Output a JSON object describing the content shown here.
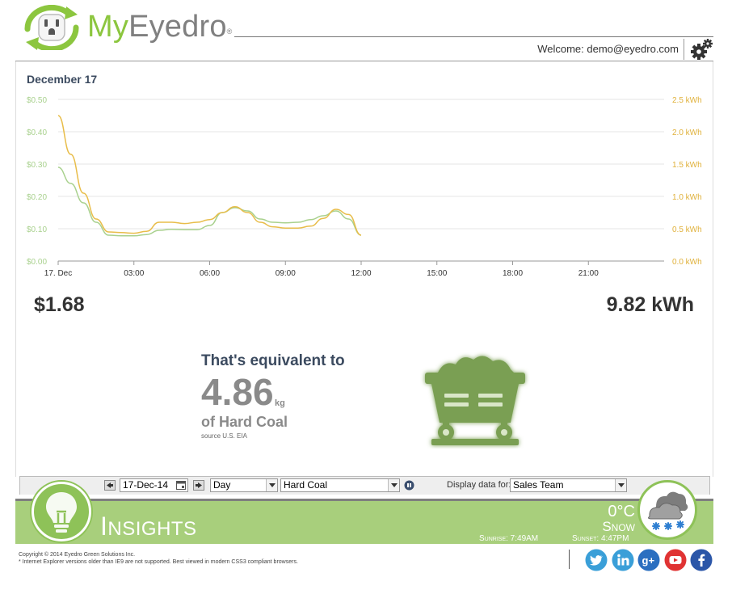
{
  "header": {
    "brand_my": "My",
    "brand_eyedro": "Eyedro",
    "brand_mark": "®",
    "welcome_text": "Welcome:  demo@eyedro.com"
  },
  "chart_data": {
    "type": "line",
    "title": "December 17",
    "x_ticks": [
      "17. Dec",
      "03:00",
      "06:00",
      "09:00",
      "12:00",
      "15:00",
      "18:00",
      "21:00"
    ],
    "x_range_hours": [
      0,
      24
    ],
    "y_left": {
      "ticks": [
        "$0.00",
        "$0.10",
        "$0.20",
        "$0.30",
        "$0.40",
        "$0.50"
      ],
      "range": [
        0,
        0.5
      ]
    },
    "y_right": {
      "ticks": [
        "0.0 kWh",
        "0.5 kWh",
        "1.0 kWh",
        "1.5 kWh",
        "2.0 kWh",
        "2.5 kWh"
      ],
      "range": [
        0,
        2.5
      ]
    },
    "grid": true,
    "series": [
      {
        "axis": "left",
        "color": "#a9d18e",
        "x": [
          0,
          0.5,
          1,
          1.5,
          2,
          2.5,
          3,
          3.5,
          4,
          4.5,
          5,
          5.5,
          6,
          6.5,
          7,
          7.5,
          8,
          8.5,
          9,
          9.5,
          10,
          10.5,
          11,
          11.5,
          12
        ],
        "y": [
          0.29,
          0.24,
          0.18,
          0.12,
          0.08,
          0.078,
          0.078,
          0.082,
          0.095,
          0.098,
          0.097,
          0.097,
          0.11,
          0.15,
          0.165,
          0.155,
          0.13,
          0.12,
          0.118,
          0.12,
          0.128,
          0.14,
          0.155,
          0.13,
          0.08
        ]
      },
      {
        "axis": "right",
        "color": "#e8bd4a",
        "x": [
          0,
          0.5,
          1,
          1.5,
          2,
          2.5,
          3,
          3.5,
          4,
          4.5,
          5,
          5.5,
          6,
          6.5,
          7,
          7.5,
          8,
          8.5,
          9,
          9.5,
          10,
          10.5,
          11,
          11.5,
          12
        ],
        "y": [
          2.25,
          1.65,
          1.05,
          0.65,
          0.45,
          0.44,
          0.43,
          0.46,
          0.6,
          0.6,
          0.58,
          0.6,
          0.64,
          0.75,
          0.84,
          0.75,
          0.6,
          0.53,
          0.51,
          0.51,
          0.54,
          0.66,
          0.8,
          0.72,
          0.4
        ]
      }
    ]
  },
  "summary": {
    "total_cost": "$1.68",
    "total_energy": "9.82 kWh"
  },
  "equivalent": {
    "heading": "That's equivalent to",
    "value": "4.86",
    "unit": "kg",
    "material": "of Hard Coal",
    "source": "source U.S. EIA"
  },
  "toolbar": {
    "date_value": "17-Dec-14",
    "period_value": "Day",
    "equivalence_value": "Hard Coal",
    "display_label": "Display data for:",
    "group_value": "Sales Team"
  },
  "banner": {
    "title_first": "I",
    "title_rest": "NSIGHTS",
    "temperature": "0°C",
    "condition": "Snow",
    "sunrise": "Sunrise: 7:49AM",
    "sunset": "Sunset: 4:47PM"
  },
  "footer": {
    "copyright": "Copyright © 2014 Eyedro Green Solutions Inc.",
    "browser_note": "* Internet Explorer versions older than IE9 are not supported. Best viewed in modern CSS3 compliant browsers."
  },
  "social": [
    "twitter-icon",
    "linkedin-icon",
    "google-plus-icon",
    "youtube-icon",
    "facebook-icon"
  ],
  "colors": {
    "brand_green": "#8cc63f",
    "banner_green": "#a8cf7c",
    "cost_series": "#a9d18e",
    "energy_series": "#e8bd4a"
  }
}
